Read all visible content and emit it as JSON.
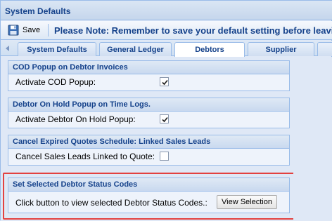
{
  "window": {
    "title": "System Defaults"
  },
  "toolbar": {
    "save_label": "Save",
    "note": "Please Note: Remember to save your default setting before leaving"
  },
  "tabs": [
    {
      "label": "System Defaults",
      "active": false
    },
    {
      "label": "General Ledger",
      "active": false
    },
    {
      "label": "Debtors",
      "active": true
    },
    {
      "label": "Supplier",
      "active": false
    }
  ],
  "sections": [
    {
      "title": "COD Popup on Debtor Invoices",
      "label": "Activate COD Popup:",
      "checked": true
    },
    {
      "title": "Debtor On Hold Popup on Time Logs.",
      "label": "Activate Debtor On Hold Popup:",
      "checked": true
    },
    {
      "title": "Cancel Expired Quotes Schedule: Linked Sales Leads",
      "label": "Cancel Sales Leads Linked to Quote:",
      "checked": false
    },
    {
      "title": "Set Selected Debtor Status Codes",
      "label": "Click button to view selected Debtor Status Codes.:",
      "button_label": "View Selection"
    }
  ],
  "icons": {
    "save": "save-icon",
    "tab_scroll": "tab-scroll-left-icon",
    "check": "checkmark-icon"
  },
  "colors": {
    "header_text": "#15428b",
    "highlight_border": "#e34140",
    "panel_border": "#99bbe8"
  }
}
